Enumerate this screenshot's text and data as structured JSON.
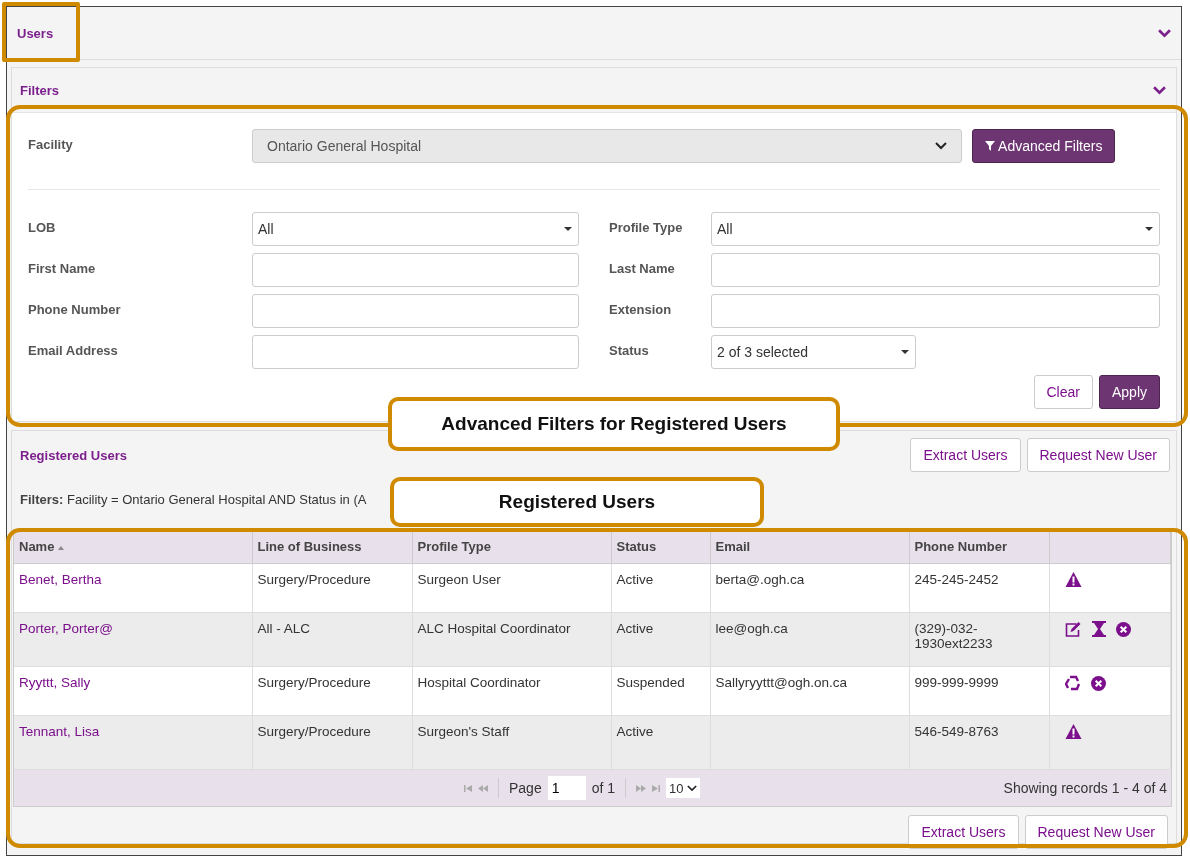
{
  "users_panel": {
    "title": "Users",
    "expanded": true
  },
  "filters_panel": {
    "title": "Filters",
    "expanded": true,
    "facility": {
      "label": "Facility",
      "value": "Ontario General Hospital"
    },
    "advanced_button": "Advanced Filters",
    "fields": [
      {
        "kind": "select",
        "label": "LOB",
        "value": "All"
      },
      {
        "kind": "select",
        "label": "Profile Type",
        "value": "All"
      },
      {
        "kind": "text",
        "label": "First Name"
      },
      {
        "kind": "text",
        "label": "Last Name"
      },
      {
        "kind": "text",
        "label": "Phone Number"
      },
      {
        "kind": "text",
        "label": "Extension"
      },
      {
        "kind": "text",
        "label": "Email Address"
      },
      {
        "kind": "multiselect",
        "label": "Status",
        "value": "2 of 3 selected"
      }
    ],
    "buttons": [
      {
        "label": "Clear",
        "primary": false
      },
      {
        "label": "Apply",
        "primary": true
      }
    ]
  },
  "registered_users": {
    "title": "Registered Users",
    "buttons": [
      "Extract Users",
      "Request New User"
    ],
    "filter_label": "Filters:",
    "filter_text": "Facility = Ontario General Hospital AND Status in (A",
    "table": {
      "columns": [
        {
          "label": "Name",
          "sorted": true
        },
        {
          "label": "Line of Business",
          "sorted": false
        },
        {
          "label": "Profile Type",
          "sorted": false
        },
        {
          "label": "Status",
          "sorted": false
        },
        {
          "label": "Email",
          "sorted": false
        },
        {
          "label": "Phone Number",
          "sorted": false
        }
      ],
      "rows": [
        {
          "name": "Benet, Bertha",
          "lob": "Surgery/Procedure",
          "profile": "Surgeon User",
          "status": "Active",
          "email": "berta@.ogh.ca",
          "phone": "245-245-2452",
          "actions": [
            {
              "kind": "warning"
            }
          ]
        },
        {
          "name": "Porter, Porter@",
          "lob": "All - ALC",
          "profile": "ALC Hospital Coordinator",
          "status": "Active",
          "email": "lee@ogh.ca",
          "phone": "(329)-032-1930ext2233",
          "actions": [
            {
              "kind": "edit"
            },
            {
              "kind": "hourglass"
            },
            {
              "kind": "remove"
            }
          ]
        },
        {
          "name": "Ryyttt, Sally",
          "lob": "Surgery/Procedure",
          "profile": "Hospital Coordinator",
          "status": "Suspended",
          "email": "Sallyryyttt@ogh.on.ca",
          "phone": "999-999-9999",
          "actions": [
            {
              "kind": "recycle"
            },
            {
              "kind": "remove"
            }
          ]
        },
        {
          "name": "Tennant, Lisa",
          "lob": "Surgery/Procedure",
          "profile": "Surgeon's Staff",
          "status": "Active",
          "phone": "546-549-8763",
          "actions": [
            {
              "kind": "warning"
            }
          ]
        }
      ]
    },
    "pager": {
      "page_label": "Page",
      "page": "1",
      "of": "of 1",
      "page_size": "10",
      "summary": "Showing records 1 - 4 of 4"
    },
    "bottom_buttons": [
      "Extract Users",
      "Request New User"
    ]
  },
  "callouts": [
    {
      "text": "Advanced Filters for Registered Users"
    },
    {
      "text": "Registered Users"
    }
  ]
}
